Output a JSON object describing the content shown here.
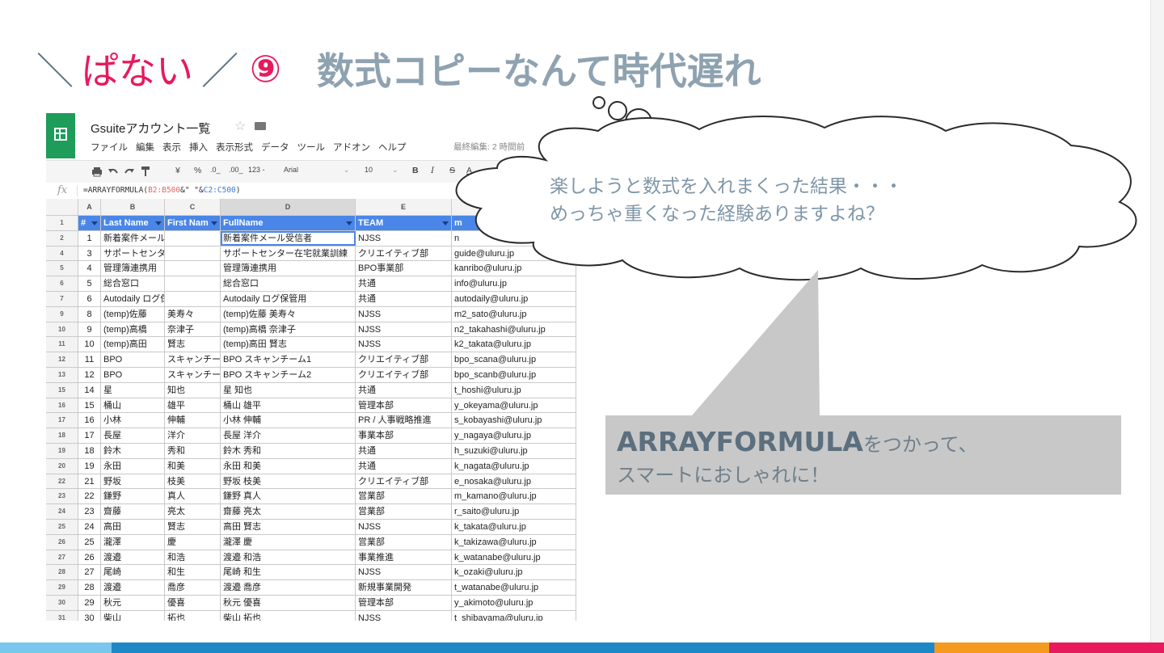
{
  "slide": {
    "title_slash": "＼",
    "title_word": "ぱない",
    "title_sep": "／",
    "title_number": "⑨",
    "title_main": "数式コピーなんて時代遅れ"
  },
  "sheet": {
    "doc_title": "Gsuiteアカウント一覧",
    "star_icon": "☆",
    "menus": [
      "ファイル",
      "編集",
      "表示",
      "挿入",
      "表示形式",
      "データ",
      "ツール",
      "アドオン",
      "ヘルプ"
    ],
    "last_edit": "最終編集: 2 時間前",
    "toolbar": {
      "currency": "¥",
      "percent": "%",
      "dec_less": ".0_",
      "dec_more": ".00_",
      "format_123": "123 -",
      "font": "Arial",
      "font_size": "10",
      "bold": "B",
      "italic": "I",
      "strike": "S",
      "text_color": "A"
    },
    "fx_label": "fx",
    "formula_parts": [
      "=ARRAYFORMULA(",
      "B2:B500",
      "&\" \"&",
      "C2:C500",
      ")"
    ],
    "col_headers": [
      "A",
      "B",
      "C",
      "D",
      "E",
      ""
    ],
    "header_row": {
      "num": "1",
      "cols": [
        "#",
        "Last Name",
        "First Nam",
        "FullName",
        "TEAM",
        "m"
      ]
    },
    "rows": [
      [
        "2",
        "1",
        "新着案件メール受信者",
        "",
        "新着案件メール受信者",
        "NJSS",
        "n"
      ],
      [
        "4",
        "3",
        "サポートセンター在宅就業訓",
        "",
        "サポートセンター在宅就業訓練",
        "クリエイティブ部",
        "guide@uluru.jp"
      ],
      [
        "5",
        "4",
        "管理簿連携用",
        "",
        "管理簿連携用",
        "BPO事業部",
        "kanribo@uluru.jp"
      ],
      [
        "6",
        "5",
        "総合窓口",
        "",
        "総合窓口",
        "共通",
        "info@uluru.jp"
      ],
      [
        "7",
        "6",
        "Autodaily ログ保管用",
        "",
        "Autodaily ログ保管用",
        "共通",
        "autodaily@uluru.jp"
      ],
      [
        "9",
        "8",
        "(temp)佐藤",
        "美寿々",
        "(temp)佐藤 美寿々",
        "NJSS",
        "m2_sato@uluru.jp"
      ],
      [
        "10",
        "9",
        "(temp)高橋",
        "奈津子",
        "(temp)高橋 奈津子",
        "NJSS",
        "n2_takahashi@uluru.jp"
      ],
      [
        "11",
        "10",
        "(temp)高田",
        "賢志",
        "(temp)高田 賢志",
        "NJSS",
        "k2_takata@uluru.jp"
      ],
      [
        "12",
        "11",
        "BPO",
        "スキャンチー",
        "BPO スキャンチーム1",
        "クリエイティブ部",
        "bpo_scana@uluru.jp"
      ],
      [
        "13",
        "12",
        "BPO",
        "スキャンチー",
        "BPO スキャンチーム2",
        "クリエイティブ部",
        "bpo_scanb@uluru.jp"
      ],
      [
        "15",
        "14",
        "星",
        "知也",
        "星 知也",
        "共通",
        "t_hoshi@uluru.jp"
      ],
      [
        "16",
        "15",
        "桶山",
        "雄平",
        "桶山 雄平",
        "管理本部",
        "y_okeyama@uluru.jp"
      ],
      [
        "17",
        "16",
        "小林",
        "伸輔",
        "小林 伸輔",
        "PR / 人事戦略推進",
        "s_kobayashi@uluru.jp"
      ],
      [
        "18",
        "17",
        "長屋",
        "洋介",
        "長屋 洋介",
        "事業本部",
        "y_nagaya@uluru.jp"
      ],
      [
        "19",
        "18",
        "鈴木",
        "秀和",
        "鈴木 秀和",
        "共通",
        "h_suzuki@uluru.jp"
      ],
      [
        "20",
        "19",
        "永田",
        "和美",
        "永田 和美",
        "共通",
        "k_nagata@uluru.jp"
      ],
      [
        "22",
        "21",
        "野坂",
        "枝美",
        "野坂 枝美",
        "クリエイティブ部",
        "e_nosaka@uluru.jp"
      ],
      [
        "23",
        "22",
        "鎌野",
        "真人",
        "鎌野 真人",
        "営業部",
        "m_kamano@uluru.jp"
      ],
      [
        "24",
        "23",
        "齋藤",
        "亮太",
        "齋藤 亮太",
        "営業部",
        "r_saito@uluru.jp"
      ],
      [
        "25",
        "24",
        "高田",
        "賢志",
        "高田 賢志",
        "NJSS",
        "k_takata@uluru.jp"
      ],
      [
        "26",
        "25",
        "瀧澤",
        "慶",
        "瀧澤 慶",
        "営業部",
        "k_takizawa@uluru.jp"
      ],
      [
        "27",
        "26",
        "渡邉",
        "和浩",
        "渡邉 和浩",
        "事業推進",
        "k_watanabe@uluru.jp"
      ],
      [
        "28",
        "27",
        "尾崎",
        "和生",
        "尾崎 和生",
        "NJSS",
        "k_ozaki@uluru.jp"
      ],
      [
        "29",
        "28",
        "渡邉",
        "喬彦",
        "渡邉 喬彦",
        "新規事業開発",
        "t_watanabe@uluru.jp"
      ],
      [
        "30",
        "29",
        "秋元",
        "優喜",
        "秋元 優喜",
        "管理本部",
        "y_akimoto@uluru.jp"
      ],
      [
        "31",
        "30",
        "柴山",
        "拓也",
        "柴山 拓也",
        "NJSS",
        "t_shibayama@uluru.jp"
      ]
    ]
  },
  "cloud": {
    "line1": "楽しようと数式を入れまくった結果・・・",
    "line2": "めっちゃ重くなった経験ありますよね？"
  },
  "callout": {
    "bold": "ARRAYFORMULA",
    "rest": "をつかって、",
    "line2": "スマートにおしゃれに！"
  },
  "colors": {
    "accent_pink": "#e8195c",
    "title_gray": "#8ea2b0",
    "sheets_green": "#1e9c5a",
    "header_blue": "#4a86e8",
    "stripe_light": "#7ac7ee",
    "stripe_blue": "#1e88c7",
    "stripe_orange": "#f39a1f",
    "stripe_red": "#e8195c"
  }
}
